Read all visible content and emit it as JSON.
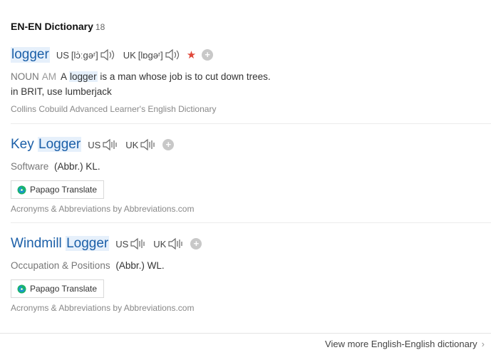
{
  "section": {
    "title": "EN-EN Dictionary",
    "count": "18"
  },
  "entries": [
    {
      "word_highlight": "logger",
      "us_label": "US",
      "us_ipa": "[lɔ̀ːgəʳ]",
      "uk_label": "UK",
      "uk_ipa": "[lɒgəʳ]",
      "pos": "NOUN",
      "pos_extra": "AM",
      "def_before": "A ",
      "def_hl": "logger",
      "def_after": " is a man whose job is to cut down trees.",
      "def_line2": "in BRIT, use lumberjack",
      "source": "Collins Cobuild Advanced Learner's English Dictionary"
    },
    {
      "word_pre": "Key ",
      "word_highlight": "Logger",
      "us_label": "US",
      "uk_label": "UK",
      "category": "Software",
      "definition": "(Abbr.) KL.",
      "papago_label": "Papago Translate",
      "source": "Acronyms & Abbreviations by Abbreviations.com"
    },
    {
      "word_pre": "Windmill ",
      "word_highlight": "Logger",
      "us_label": "US",
      "uk_label": "UK",
      "category": "Occupation & Positions",
      "definition": "(Abbr.) WL.",
      "papago_label": "Papago Translate",
      "source": "Acronyms & Abbreviations by Abbreviations.com"
    }
  ],
  "icons": {
    "speaker": "speaker-icon",
    "star": "star-icon",
    "plus": "plus-icon",
    "papago": "papago-icon",
    "chevron": "chevron-right-icon"
  },
  "colors": {
    "word": "#1b5fa8",
    "highlight": "#e6f0fb",
    "star": "#e0483a"
  },
  "footer": {
    "more_label": "View more English-English dictionary"
  }
}
